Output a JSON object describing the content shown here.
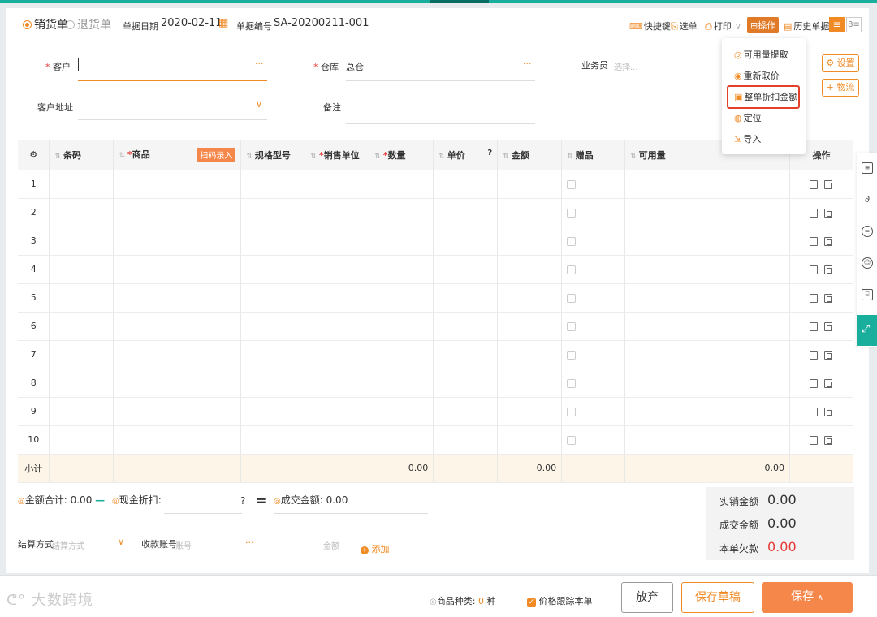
{
  "tabs": {
    "sales": "销货单",
    "return": "退货单"
  },
  "header": {
    "date_label": "单据日期",
    "date_value": "2020-02-11",
    "no_label": "单据编号",
    "no_value": "SA-20200211-001"
  },
  "toolbar": {
    "shortcut": "快捷键",
    "select": "选单",
    "print": "打印",
    "operate": "操作",
    "history": "历史单据"
  },
  "menu": {
    "items": [
      "可用量提取",
      "重新取价",
      "整单折扣金额",
      "定位",
      "导入"
    ]
  },
  "form": {
    "customer_label": "客户",
    "warehouse_label": "仓库",
    "warehouse_value": "总仓",
    "sales_label": "业务员",
    "sales_placeholder": "选择...",
    "address_label": "客户地址",
    "remark_label": "备注",
    "dots": "···"
  },
  "side_buttons": {
    "settings": "设置",
    "logistics": "物流"
  },
  "grid": {
    "headers": {
      "barcode": "条码",
      "product": "商品",
      "scan": "扫码录入",
      "spec": "规格型号",
      "unit": "销售单位",
      "qty": "数量",
      "price": "单价",
      "amount": "金额",
      "gift": "赠品",
      "avail": "可用量",
      "ops": "操作"
    },
    "rows": [
      "1",
      "2",
      "3",
      "4",
      "5",
      "6",
      "7",
      "8",
      "9",
      "10"
    ],
    "subtotal_label": "小计",
    "subtotal_qty": "0.00",
    "subtotal_amount": "0.00",
    "subtotal_avail": "0.00"
  },
  "totals": {
    "sum_label": "金额合计:",
    "sum_value": "0.00",
    "discount_label": "现金折扣:",
    "deal_label": "成交金额:",
    "deal_value": "0.00"
  },
  "settle": {
    "method_label": "结算方式",
    "method_placeholder": "结算方式",
    "account_label": "收款账号",
    "account_placeholder": "账号",
    "amount_placeholder": "金额",
    "add_label": "添加"
  },
  "summary": {
    "real_label": "实销金额",
    "real_value": "0.00",
    "deal_label": "成交金额",
    "deal_value": "0.00",
    "owe_label": "本单欠款",
    "owe_value": "0.00"
  },
  "footer": {
    "watermark": "大数跨境",
    "kinds_label": "商品种类:",
    "kinds_value": "0",
    "kinds_unit": "种",
    "track_label": "价格跟踪本单",
    "discard": "放弃",
    "draft": "保存草稿",
    "save": "保存"
  },
  "colors": {
    "accent": "#f08a24",
    "teal": "#1aae9c",
    "danger": "#e53935"
  }
}
